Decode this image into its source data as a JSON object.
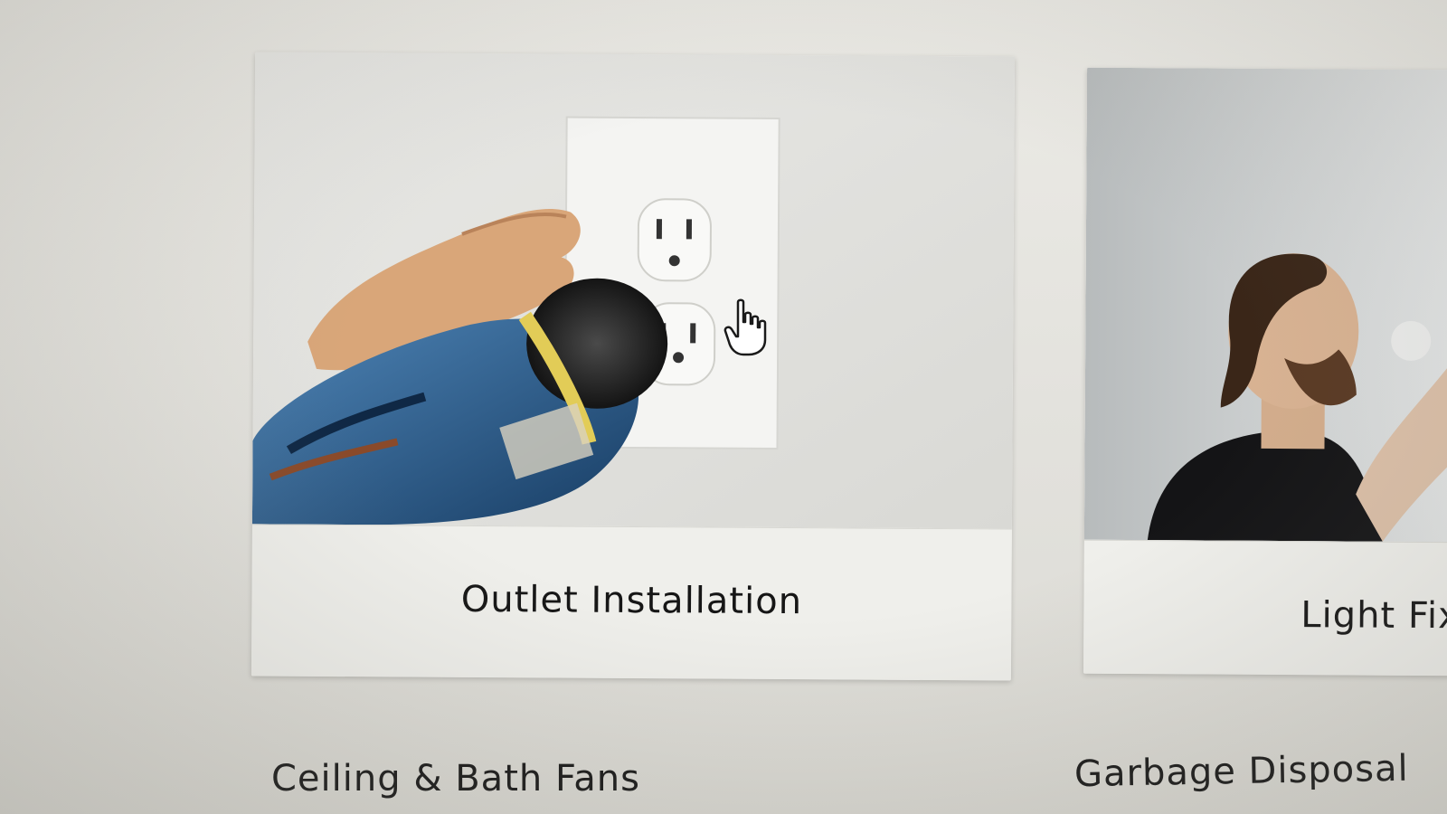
{
  "services": {
    "cards": [
      {
        "label": "Outlet Installation",
        "image_icon": "outlet-drill-photo"
      },
      {
        "label": "Light Fix",
        "image_icon": "man-fixing-light-photo"
      }
    ],
    "next_row": [
      {
        "label": "Ceiling & Bath Fans"
      },
      {
        "label": "Garbage Disposal"
      }
    ]
  },
  "cursor": {
    "icon": "hand-pointer-icon"
  }
}
